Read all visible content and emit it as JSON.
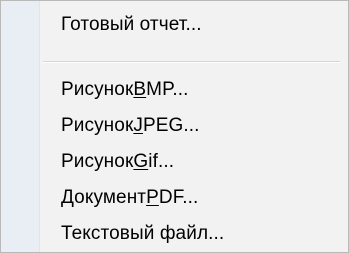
{
  "menu": {
    "items": [
      {
        "label": "Готовый отчет...",
        "pre": "Готовый отчет...",
        "mnemonic": "",
        "post": ""
      },
      {
        "label": "Рисунок BMP...",
        "pre": "Рисунок ",
        "mnemonic": "B",
        "post": "MP..."
      },
      {
        "label": "Рисунок JPEG...",
        "pre": "Рисунок ",
        "mnemonic": "J",
        "post": "PEG..."
      },
      {
        "label": "Рисунок Gif...",
        "pre": "Рисунок ",
        "mnemonic": "G",
        "post": "if..."
      },
      {
        "label": "Документ PDF...",
        "pre": "Документ ",
        "mnemonic": "P",
        "post": "DF..."
      },
      {
        "label": "Текстовый файл...",
        "pre": "Текстовый файл...",
        "mnemonic": "",
        "post": ""
      }
    ],
    "colors": {
      "background": "#f2f2f2",
      "gutter": "#e9eef5",
      "separator": "#d6d6d6",
      "border": "#b9b9b9",
      "text": "#000000"
    }
  }
}
